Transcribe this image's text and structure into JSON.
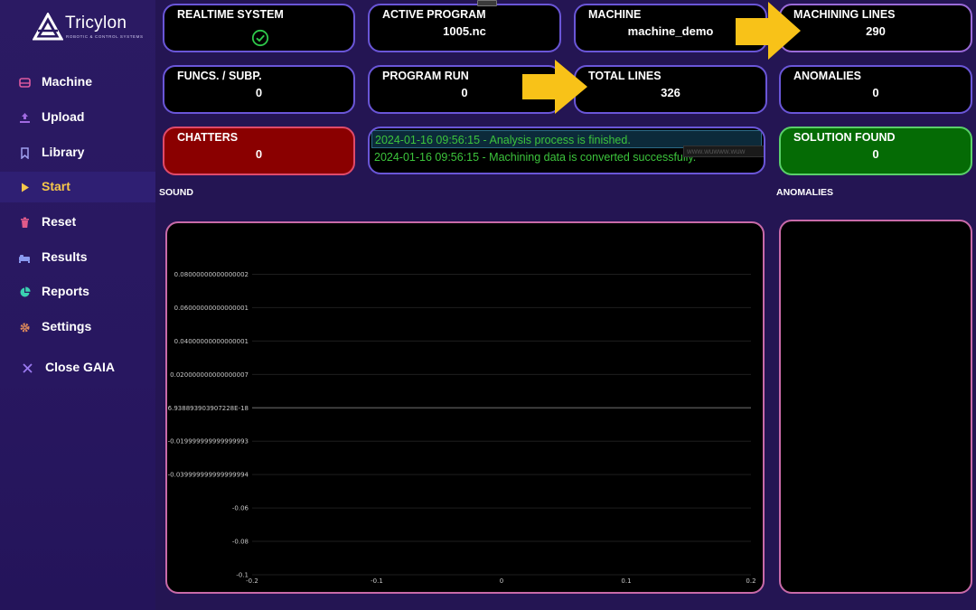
{
  "sidebar": {
    "logo": {
      "name": "Tricylon",
      "tagline": "ROBOTIC & CONTROL SYSTEMS"
    },
    "items": [
      {
        "label": "Machine",
        "icon": "machine-icon",
        "color": "#e05aa0"
      },
      {
        "label": "Upload",
        "icon": "upload-icon",
        "color": "#a06ae0"
      },
      {
        "label": "Library",
        "icon": "bookmark-icon",
        "color": "#a0a0f0"
      },
      {
        "label": "Start",
        "icon": "play-icon",
        "color": "#f6c74a",
        "active": true
      },
      {
        "label": "Reset",
        "icon": "trash-icon",
        "color": "#e05a8a"
      },
      {
        "label": "Results",
        "icon": "results-icon",
        "color": "#8a9af0"
      },
      {
        "label": "Reports",
        "icon": "pie-chart-icon",
        "color": "#3ad0b0"
      },
      {
        "label": "Settings",
        "icon": "gear-icon",
        "color": "#e08a5a"
      }
    ],
    "close": {
      "label": "Close GAIA",
      "icon": "close-icon",
      "color": "#9a7af0"
    }
  },
  "cards": {
    "realtime": {
      "title": "REALTIME SYSTEM",
      "icon": "check-circle-icon"
    },
    "active_program": {
      "title": "ACTIVE PROGRAM",
      "value": "1005.nc"
    },
    "machine": {
      "title": "MACHINE",
      "value": "machine_demo"
    },
    "machining_lines": {
      "title": "MACHINING LINES",
      "value": "290"
    },
    "funcs": {
      "title": "FUNCS. / SUBP.",
      "value": "0"
    },
    "program_run": {
      "title": "PROGRAM RUN",
      "value": "0"
    },
    "total_lines": {
      "title": "TOTAL LINES",
      "value": "326"
    },
    "anomalies": {
      "title": "ANOMALIES",
      "value": "0"
    },
    "chatters": {
      "title": "CHATTERS",
      "value": "0"
    },
    "solution": {
      "title": "SOLUTION FOUND",
      "value": "0"
    }
  },
  "log": {
    "lines": [
      "2024-01-16 09:56:15 - Analysis process is finished.",
      "2024-01-16 09:56:15 - Machining data is converted successfully."
    ],
    "tooltip": "www.wuwww.wuw"
  },
  "sections": {
    "sound": "SOUND",
    "anomalies": "ANOMALIES"
  },
  "colors": {
    "background": "#241553",
    "accent": "#f6c74a",
    "card_border": "#6a56d8",
    "chatters_bg": "#8a0000",
    "solution_bg": "#056b05",
    "log_text": "#3cc43c",
    "arrow": "#f8c218"
  },
  "chart_data": {
    "type": "line",
    "title": "",
    "xlabel": "",
    "ylabel": "",
    "xlim": [
      -0.2,
      0.2
    ],
    "ylim": [
      -0.1,
      0.09
    ],
    "x_ticks": [
      "-0.2",
      "-0.1",
      "0",
      "0.1",
      "0.2"
    ],
    "x_tick_values": [
      -0.2,
      -0.1,
      0,
      0.1,
      0.2
    ],
    "y_ticks": [
      "0.08000000000000002",
      "0.06000000000000001",
      "0.04000000000000001",
      "0.020000000000000007",
      "6.938893903907228E-18",
      "-0.019999999999999993",
      "-0.039999999999999994",
      "-0.06",
      "-0.08",
      "-0.1"
    ],
    "y_tick_values": [
      0.08,
      0.06,
      0.04,
      0.02,
      0,
      -0.02,
      -0.04,
      -0.06,
      -0.08,
      -0.1
    ],
    "series": [],
    "grid": true
  }
}
